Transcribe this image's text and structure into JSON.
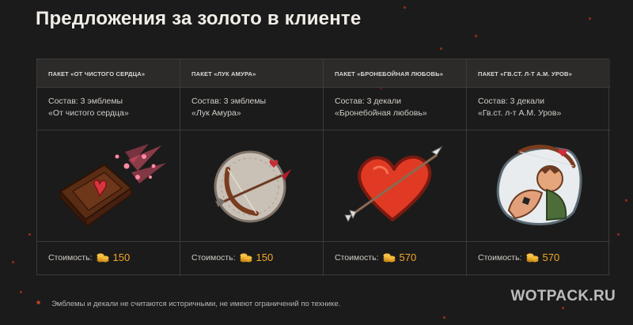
{
  "page": {
    "title": "Предложения за золото в клиенте"
  },
  "packages": [
    {
      "header": "ПАКЕТ «ОТ ЧИСТОГО СЕРДЦА»",
      "contents_line1": "Состав: 3 эмблемы",
      "contents_line2": "«От чистого сердца»",
      "image_icon": "flying-chocolate-heart-icon",
      "price_label": "Стоимость:",
      "price_value": "150"
    },
    {
      "header": "ПАКЕТ «ЛУК АМУРА»",
      "contents_line1": "Состав: 3 эмблемы",
      "contents_line2": "«Лук Амура»",
      "image_icon": "cupid-bow-icon",
      "price_label": "Стоимость:",
      "price_value": "150"
    },
    {
      "header": "ПАКЕТ «БРОНЕБОЙНАЯ ЛЮБОВЬ»",
      "contents_line1": "Состав: 3 декали",
      "contents_line2": "«Бронебойная любовь»",
      "image_icon": "arrow-through-heart-icon",
      "price_label": "Стоимость:",
      "price_value": "570"
    },
    {
      "header": "ПАКЕТ «ГВ.СТ. Л-Т А.М. УРОВ»",
      "contents_line1": "Состав: 3 декали",
      "contents_line2": "«Гв.ст. л-т А.М. Уров»",
      "image_icon": "cupid-archer-icon",
      "price_label": "Стоимость:",
      "price_value": "570"
    }
  ],
  "currency_icon": "gold-coins-icon",
  "footnote": {
    "marker": "*",
    "text": "Эмблемы и декали не считаются историчными, не имеют ограничений по технике."
  },
  "watermark": "WOTPACK.RU",
  "colors": {
    "background": "#1c1b1b",
    "header_background": "#2c2b2a",
    "gold_price": "#f0a928",
    "footnote_marker": "#e2452d"
  }
}
